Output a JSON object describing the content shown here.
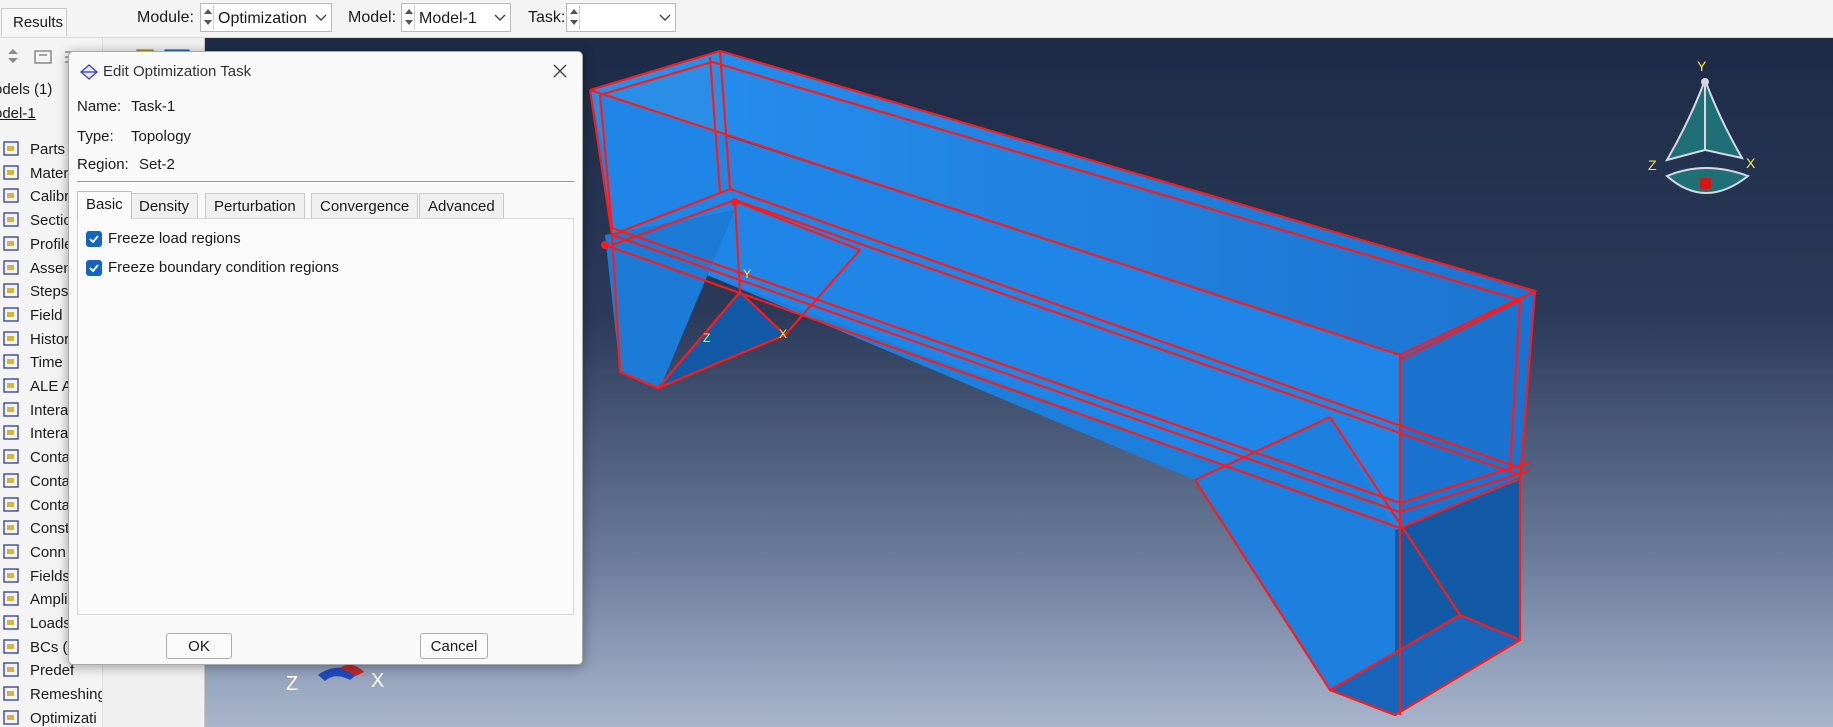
{
  "context_bar": {
    "results_tab": "Results",
    "module_label": "Module:",
    "module_value": "Optimization",
    "model_label": "Model:",
    "model_value": "Model-1",
    "task_label": "Task:",
    "task_value": ""
  },
  "tree": {
    "models_header": "odels (1)",
    "model_name": "odel-1",
    "items": [
      {
        "label": "Parts",
        "icon": "parts-icon"
      },
      {
        "label": "Mater",
        "icon": "materials-icon"
      },
      {
        "label": "Calibr",
        "icon": "calibrations-icon"
      },
      {
        "label": "Sectio",
        "icon": "sections-icon"
      },
      {
        "label": "Profile",
        "icon": "profiles-icon"
      },
      {
        "label": "Assen",
        "icon": "assembly-icon"
      },
      {
        "label": "Steps",
        "icon": "steps-icon"
      },
      {
        "label": "Field",
        "icon": "field-output-icon"
      },
      {
        "label": "Histor",
        "icon": "history-output-icon"
      },
      {
        "label": "Time",
        "icon": "time-points-icon"
      },
      {
        "label": "ALE A",
        "icon": "ale-icon"
      },
      {
        "label": "Intera",
        "icon": "interactions-icon"
      },
      {
        "label": "Intera",
        "icon": "interaction-properties-icon"
      },
      {
        "label": "Conta",
        "icon": "contact-controls-icon"
      },
      {
        "label": "Conta",
        "icon": "contact-initialization-icon"
      },
      {
        "label": "Conta",
        "icon": "contact-stabilization-icon"
      },
      {
        "label": "Const",
        "icon": "constraints-icon"
      },
      {
        "label": "Conn",
        "icon": "connector-sections-icon"
      },
      {
        "label": "Fields",
        "icon": "fields-icon"
      },
      {
        "label": "Ampli",
        "icon": "amplitudes-icon"
      },
      {
        "label": "Loads",
        "icon": "loads-icon"
      },
      {
        "label": "BCs (",
        "icon": "bcs-icon"
      },
      {
        "label": "Predef",
        "icon": "predefined-fields-icon"
      },
      {
        "label": "Remeshing",
        "icon": "remeshing-icon"
      },
      {
        "label": "Optimizati",
        "icon": "optimization-icon"
      }
    ]
  },
  "dialog": {
    "title": "Edit Optimization Task",
    "name_label": "Name:",
    "name_value": "Task-1",
    "type_label": "Type:",
    "type_value": "Topology",
    "region_label": "Region:",
    "region_value": "Set-2",
    "tabs": [
      "Basic",
      "Density",
      "Perturbation",
      "Convergence",
      "Advanced"
    ],
    "active_tab": "Basic",
    "options": [
      {
        "label": "Freeze load regions",
        "checked": true
      },
      {
        "label": "Freeze boundary condition regions",
        "checked": true
      }
    ],
    "ok_label": "OK",
    "cancel_label": "Cancel"
  },
  "viewport": {
    "triad_y": "Y",
    "triad_z": "Z",
    "triad_x": "X",
    "local_csys_y": "Y",
    "local_csys_z": "Z",
    "local_csys_x": "X",
    "bottom_triad_z": "Z",
    "bottom_triad_x": "X",
    "colors": {
      "face": "#1f86e8",
      "face_dark": "#135aa6",
      "edge": "#ff1a1a",
      "triad_fill": "#1f6f77",
      "triad_label": "#f4e64a"
    }
  }
}
